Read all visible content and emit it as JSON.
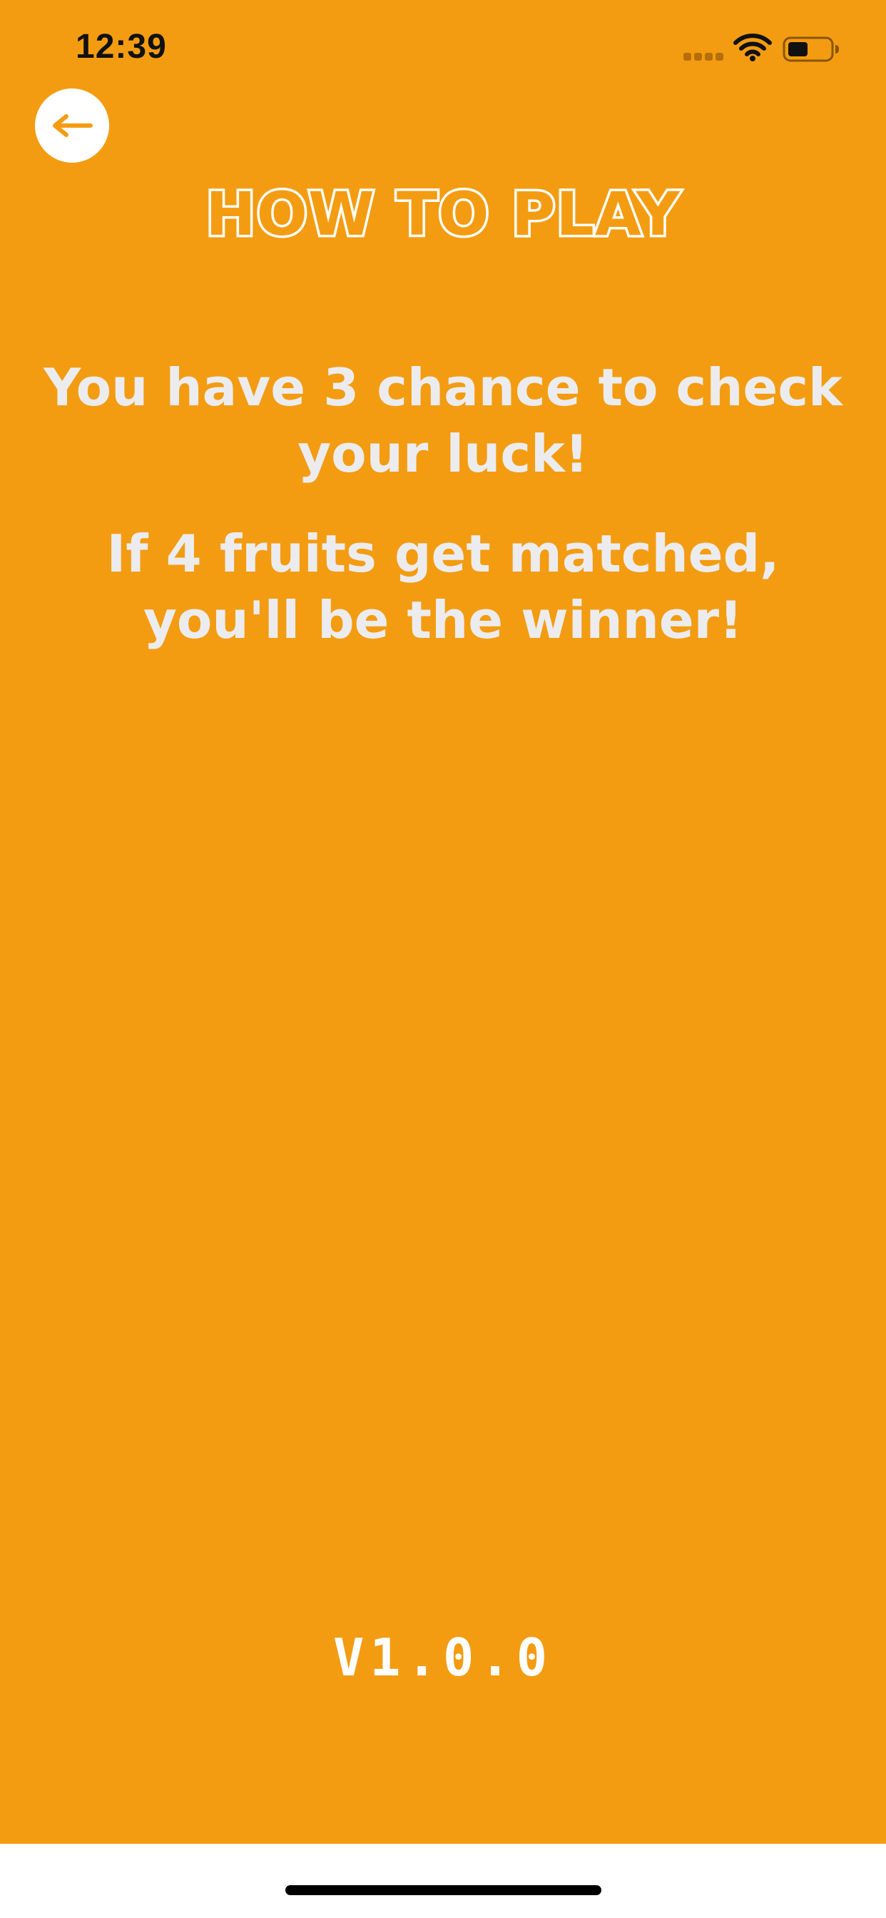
{
  "status_bar": {
    "time": "12:39",
    "icons": [
      "cellular-signal-icon",
      "wifi-icon",
      "battery-icon"
    ]
  },
  "header": {
    "back_icon": "arrow-left-icon",
    "title": "HOW TO PLAY"
  },
  "instructions": [
    "You have 3 chance to check your luck!",
    "If 4 fruits get matched, you'll be the winner!"
  ],
  "footer": {
    "version": "V1.0.0"
  },
  "colors": {
    "background": "#F39C12",
    "text": "#ECECEE",
    "button": "#FFFFFF",
    "bottom_bar": "#FFFFFF"
  }
}
